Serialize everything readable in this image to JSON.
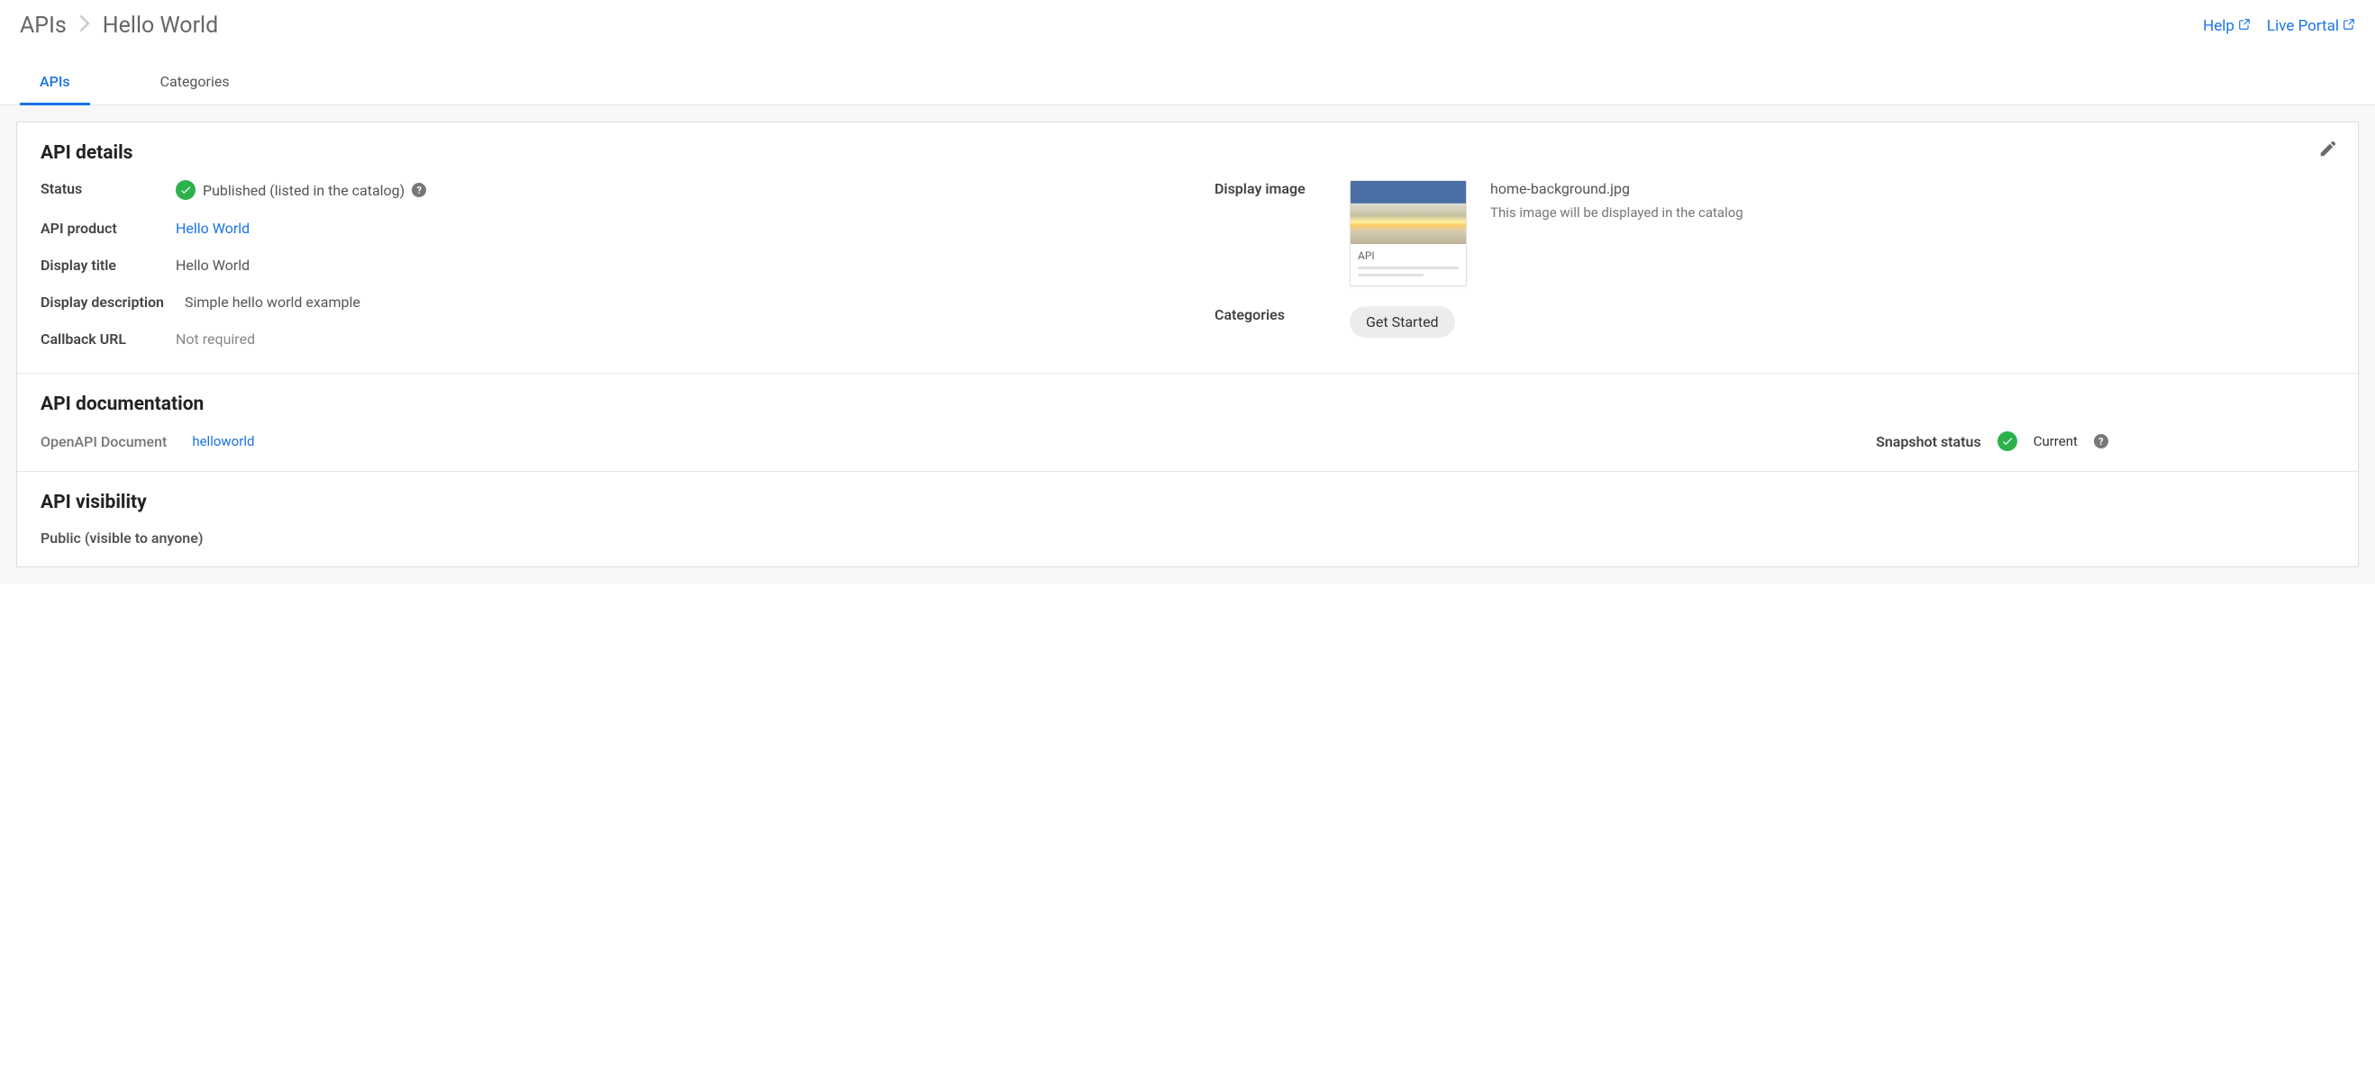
{
  "breadcrumb": {
    "root": "APIs",
    "current": "Hello World"
  },
  "topLinks": {
    "help": "Help",
    "livePortal": "Live Portal"
  },
  "tabs": [
    {
      "label": "APIs",
      "active": true
    },
    {
      "label": "Categories",
      "active": false
    }
  ],
  "details": {
    "title": "API details",
    "statusLabel": "Status",
    "statusValue": "Published (listed in the catalog)",
    "apiProductLabel": "API product",
    "apiProductValue": "Hello World",
    "displayTitleLabel": "Display title",
    "displayTitleValue": "Hello World",
    "displayDescriptionLabel": "Display description",
    "displayDescriptionValue": "Simple hello world example",
    "callbackUrlLabel": "Callback URL",
    "callbackUrlValue": "Not required",
    "displayImageLabel": "Display image",
    "imageFilename": "home-background.jpg",
    "imageHelp": "This image will be displayed in the catalog",
    "thumbCaption": "API",
    "categoriesLabel": "Categories",
    "categoriesChip": "Get Started"
  },
  "documentation": {
    "title": "API documentation",
    "openapiLabel": "OpenAPI Document",
    "openapiLink": "helloworld",
    "snapshotLabel": "Snapshot status",
    "snapshotValue": "Current"
  },
  "visibility": {
    "title": "API visibility",
    "value": "Public (visible to anyone)"
  }
}
